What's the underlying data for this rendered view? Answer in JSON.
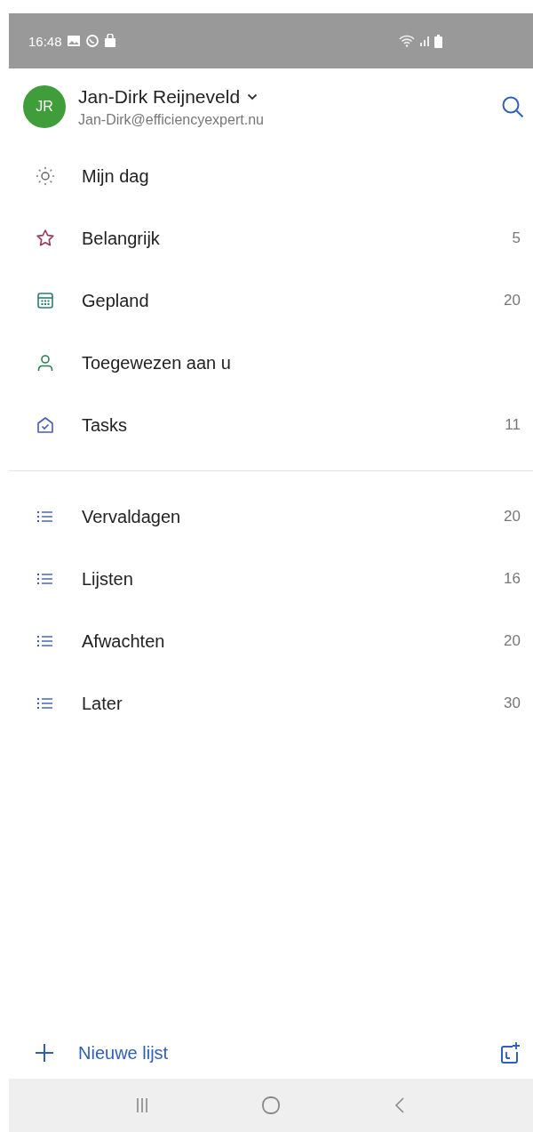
{
  "status_bar": {
    "time": "16:48"
  },
  "account": {
    "initials": "JR",
    "name": "Jan-Dirk Reijneveld",
    "email": "Jan-Dirk@efficiencyexpert.nu",
    "expanded": false
  },
  "smart_lists": [
    {
      "label": "Mijn dag"
    },
    {
      "label": "Belangrijk",
      "count": "5"
    },
    {
      "label": "Gepland",
      "count": "20"
    },
    {
      "label": "Toegewezen aan u"
    },
    {
      "label": "Tasks",
      "count": "11"
    }
  ],
  "lists": [
    {
      "label": "Vervaldagen",
      "count": "20"
    },
    {
      "label": "Lijsten",
      "count": "16"
    },
    {
      "label": "Afwachten",
      "count": "20"
    },
    {
      "label": "Later",
      "count": "30"
    }
  ],
  "footer": {
    "new_list": "Nieuwe lijst"
  }
}
